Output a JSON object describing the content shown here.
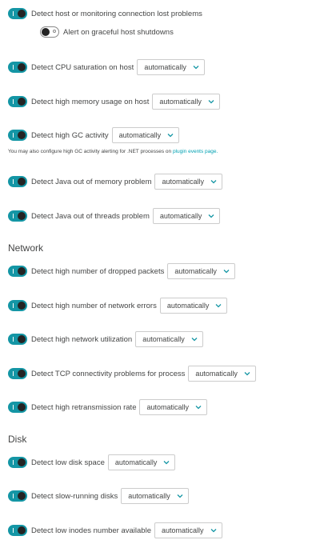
{
  "options": {
    "select_value": "automatically"
  },
  "host": {
    "connection_lost": "Detect host or monitoring connection lost problems",
    "graceful_shutdown": "Alert on graceful host shutdowns",
    "cpu_saturation": "Detect CPU saturation on host",
    "memory_usage": "Detect high memory usage on host",
    "gc_activity": "Detect high GC activity",
    "gc_note_prefix": "You may also configure high GC activity alerting for .NET processes on ",
    "gc_note_link": "plugin events page.",
    "java_oom": "Detect Java out of memory problem",
    "java_threads": "Detect Java out of threads problem"
  },
  "network": {
    "title": "Network",
    "dropped_packets": "Detect high number of dropped packets",
    "network_errors": "Detect high number of network errors",
    "network_utilization": "Detect high network utilization",
    "tcp_connectivity": "Detect TCP connectivity problems for process",
    "retransmission": "Detect high retransmission rate"
  },
  "disk": {
    "title": "Disk",
    "low_space": "Detect low disk space",
    "slow_running": "Detect slow-running disks",
    "low_inodes": "Detect low inodes number available"
  },
  "colors": {
    "accent": "#1496a5",
    "link": "#00a1b2",
    "text": "#454646"
  }
}
